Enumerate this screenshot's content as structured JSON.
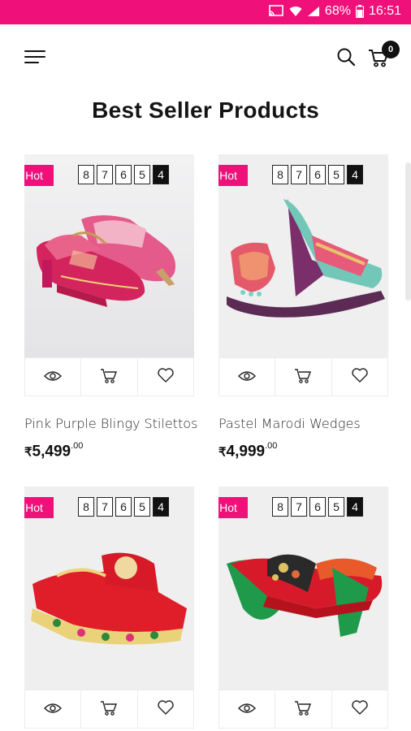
{
  "status_bar": {
    "battery": "68%",
    "time": "16:51"
  },
  "header": {
    "cart_count": "0"
  },
  "section": {
    "title": "Best Seller Products"
  },
  "colors": {
    "accent": "#f0107a",
    "dark": "#111111",
    "card_bg": "#eeeeef"
  },
  "products": [
    {
      "badge": "Hot",
      "sizes": [
        "8",
        "7",
        "6",
        "5",
        "4"
      ],
      "selected_size": "4",
      "name": "Pink Purple Blingy Stilettos",
      "currency": "₹",
      "price": "5,499",
      "price_decimal": ".00"
    },
    {
      "badge": "Hot",
      "sizes": [
        "8",
        "7",
        "6",
        "5",
        "4"
      ],
      "selected_size": "4",
      "name": "Pastel Marodi Wedges",
      "currency": "₹",
      "price": "4,999",
      "price_decimal": ".00"
    },
    {
      "badge": "Hot",
      "sizes": [
        "8",
        "7",
        "6",
        "5",
        "4"
      ],
      "selected_size": "4"
    },
    {
      "badge": "Hot",
      "sizes": [
        "8",
        "7",
        "6",
        "5",
        "4"
      ],
      "selected_size": "4"
    }
  ],
  "icons": {
    "menu": "hamburger-icon",
    "search": "search-icon",
    "cart": "cart-icon",
    "quick_view": "eye-icon",
    "add_to_cart": "cart-icon",
    "wishlist": "heart-icon"
  }
}
